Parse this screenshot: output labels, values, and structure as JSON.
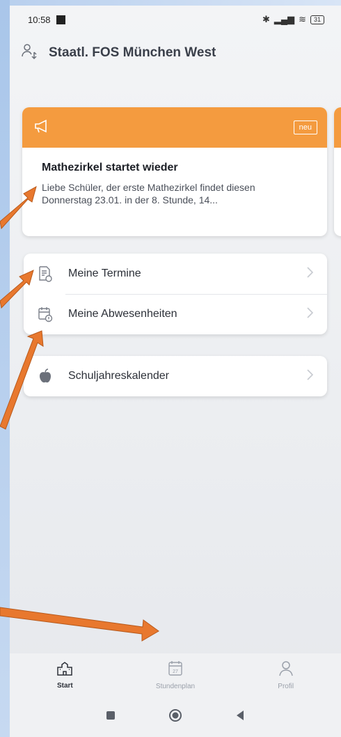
{
  "status_bar": {
    "time": "10:58",
    "battery": "31"
  },
  "header": {
    "school_name": "Staatl. FOS München West",
    "switch_icon": "person-switch-icon"
  },
  "news": {
    "badge": "neu",
    "title": "Mathezirkel startet wieder",
    "text": "Liebe Schüler, der erste Mathezirkel findet diesen Donnerstag 23.01. in der 8. Stunde, 14..."
  },
  "menu": {
    "items": [
      {
        "label": "Meine Termine",
        "icon": "appointments-icon"
      },
      {
        "label": "Meine Abwesenheiten",
        "icon": "absence-calendar-icon"
      }
    ],
    "calendar": {
      "label": "Schuljahreskalender",
      "icon": "apple-icon"
    }
  },
  "tabs": [
    {
      "label": "Start",
      "icon": "school-icon",
      "active": true
    },
    {
      "label": "Stundenplan",
      "icon": "timetable-icon",
      "active": false
    },
    {
      "label": "Profil",
      "icon": "person-icon",
      "active": false
    }
  ],
  "colors": {
    "accent": "#f49b3f",
    "arrow": "#e8782e",
    "frame": "#b8cfee"
  }
}
